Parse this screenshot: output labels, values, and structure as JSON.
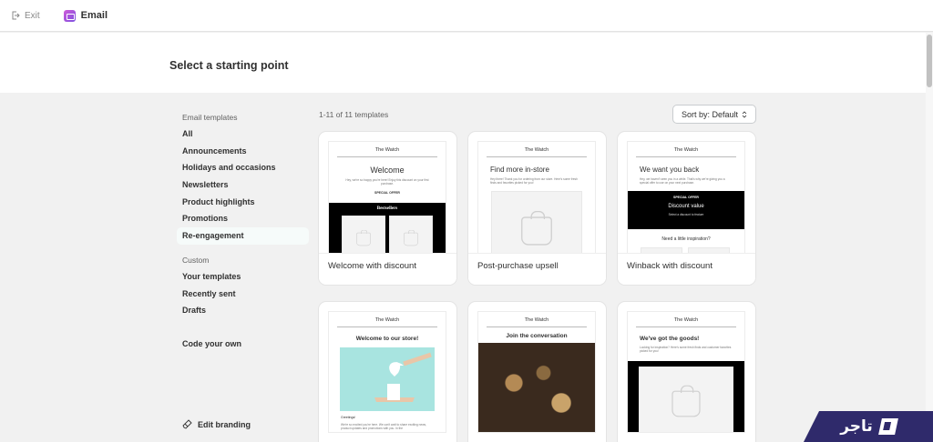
{
  "topbar": {
    "exit_label": "Exit",
    "app_title": "Email"
  },
  "header": {
    "title": "Select a starting point"
  },
  "sidebar": {
    "section_email": "Email templates",
    "email_items": [
      "All",
      "Announcements",
      "Holidays and occasions",
      "Newsletters",
      "Product highlights",
      "Promotions",
      "Re-engagement"
    ],
    "active_item": "Re-engagement",
    "section_custom": "Custom",
    "custom_items": [
      "Your templates",
      "Recently sent",
      "Drafts"
    ],
    "code_own": "Code your own",
    "edit_branding": "Edit branding"
  },
  "templates": {
    "count_label": "1-11 of 11 templates",
    "sort_label": "Sort by: Default",
    "cards": [
      {
        "label": "Welcome with discount",
        "brand": "The Watch",
        "heading": "Welcome",
        "body": "Hey, we're so happy you're here! Enjoy this discount on your first purchase.",
        "badge": "SPECIAL OFFER",
        "section": "Bestsellers"
      },
      {
        "label": "Post-purchase upsell",
        "brand": "The Watch",
        "heading": "Find more in-store",
        "body": "Hey there! Thank you for ordering from our store. Here's some fresh finds and favorites picked for you!"
      },
      {
        "label": "Winback with discount",
        "brand": "The Watch",
        "heading": "We want you back",
        "body": "Hey, we haven't seen you in a while. That's why we're giving you a special offer to use on your next purchase.",
        "badge": "SPECIAL OFFER",
        "offer_title": "Discount value",
        "offer_sub": "Select a discount to feature",
        "footer": "Need a little inspiration?"
      },
      {
        "label": "",
        "brand": "The Watch",
        "heading": "Welcome to our store!",
        "greeting": "Greetings!",
        "body": "We're so excited you're here. We can't wait to share exciting news, product updates and promotions with you. In the"
      },
      {
        "label": "",
        "brand": "The Watch",
        "heading": "Join the conversation"
      },
      {
        "label": "",
        "brand": "The Watch",
        "heading": "We've got the goods!",
        "body": "Looking for inspiration? Here's some fresh finds and customer favorites picked for you!"
      }
    ]
  },
  "branding_logo": {
    "text": "تاجر"
  },
  "colors": {
    "page_bg": "#f1f1f1",
    "logo_bg": "#2f2a6b",
    "app_icon": "#b44fe0"
  }
}
